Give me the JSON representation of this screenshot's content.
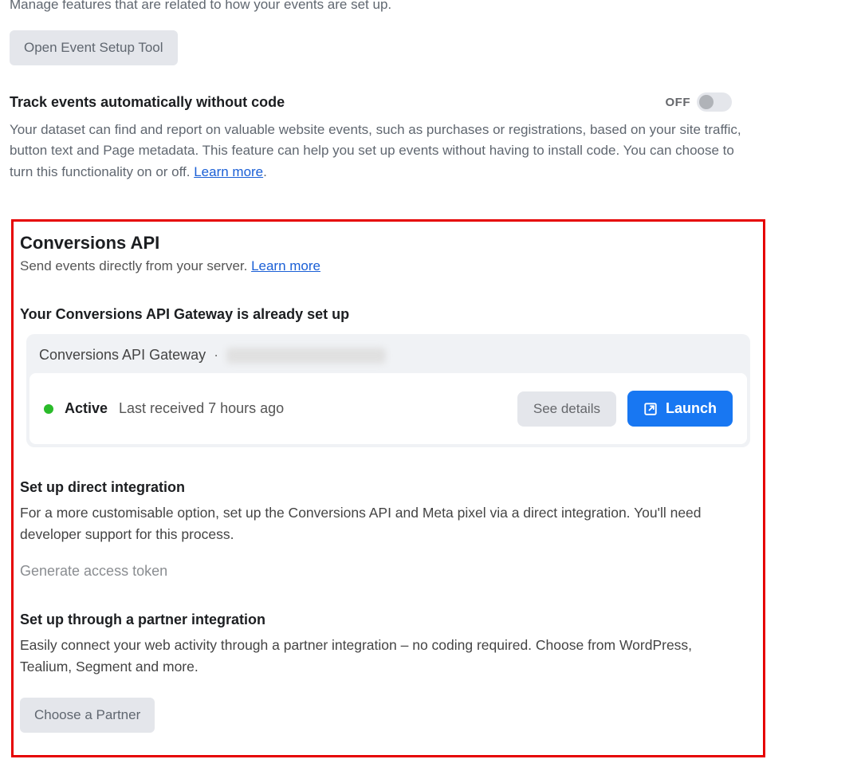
{
  "intro_text": "Manage features that are related to how your events are set up.",
  "open_event_setup_tool": "Open Event Setup Tool",
  "track_events": {
    "title": "Track events automatically without code",
    "toggle_state": "OFF",
    "description": "Your dataset can find and report on valuable website events, such as purchases or registrations, based on your site traffic, button text and Page metadata. This feature can help you set up events without having to install code. You can choose to turn this functionality on or off. ",
    "learn_more": "Learn more"
  },
  "capi": {
    "title": "Conversions API",
    "subtitle": "Send events directly from your server. ",
    "learn_more": "Learn more",
    "gateway_heading": "Your Conversions API Gateway is already set up",
    "card": {
      "title": "Conversions API Gateway",
      "status_label": "Active",
      "status_detail": "Last received 7 hours ago",
      "see_details": "See details",
      "launch": "Launch"
    },
    "direct": {
      "title": "Set up direct integration",
      "description": "For a more customisable option, set up the Conversions API and Meta pixel via a direct integration. You'll need developer support for this process.",
      "generate_token": "Generate access token"
    },
    "partner": {
      "title": "Set up through a partner integration",
      "description": "Easily connect your web activity through a partner integration – no coding required. Choose from WordPress, Tealium, Segment and more.",
      "choose_partner": "Choose a Partner"
    }
  }
}
